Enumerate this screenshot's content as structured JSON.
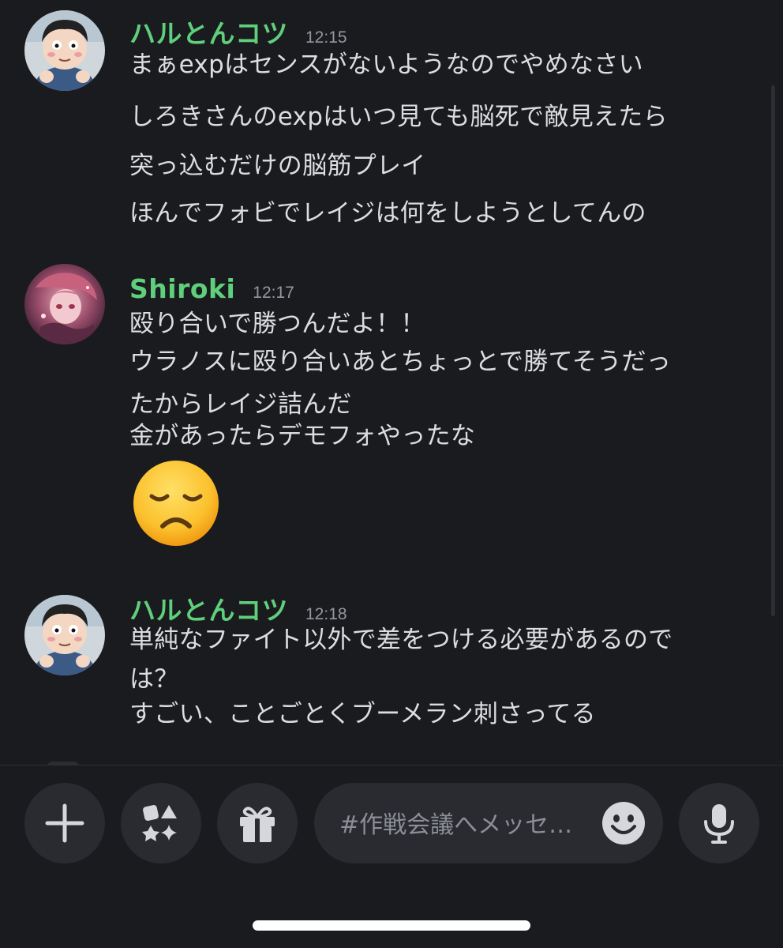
{
  "messages": [
    {
      "username": "ハルとんコツ",
      "time": "12:15",
      "lines": [
        "まぁexpはセンスがないようなのでやめなさい",
        "しろきさんのexpはいつ見ても脳死で敵見えたら",
        "突っ込むだけの脳筋プレイ",
        "ほんでフォビでレイジは何をしようとしてんの"
      ]
    },
    {
      "username": "Shiroki",
      "time": "12:17",
      "lines": [
        "殴り合いで勝つんだよ！！",
        "ウラノスに殴り合いあとちょっとで勝てそうだっ",
        "たからレイジ詰んだ",
        "金があったらデモフォやったな"
      ],
      "emoji": "disappointed-face"
    },
    {
      "username": "ハルとんコツ",
      "time": "12:18",
      "lines": [
        "単純なファイト以外で差をつける必要があるので",
        "は？",
        "すごい、ことごとくブーメラン刺さってる"
      ]
    }
  ],
  "composer": {
    "placeholder": "#作戦会議へメッセージを送信",
    "buttons": [
      "plus-icon",
      "apps-icon",
      "gift-icon",
      "microphone-icon"
    ],
    "emoji_icon": "smiley-icon"
  },
  "colors": {
    "background": "#1a1b1f",
    "username": "#5fcf7b",
    "text": "#dcdde1",
    "timestamp": "#94979e",
    "button_bg": "#2a2b30"
  }
}
